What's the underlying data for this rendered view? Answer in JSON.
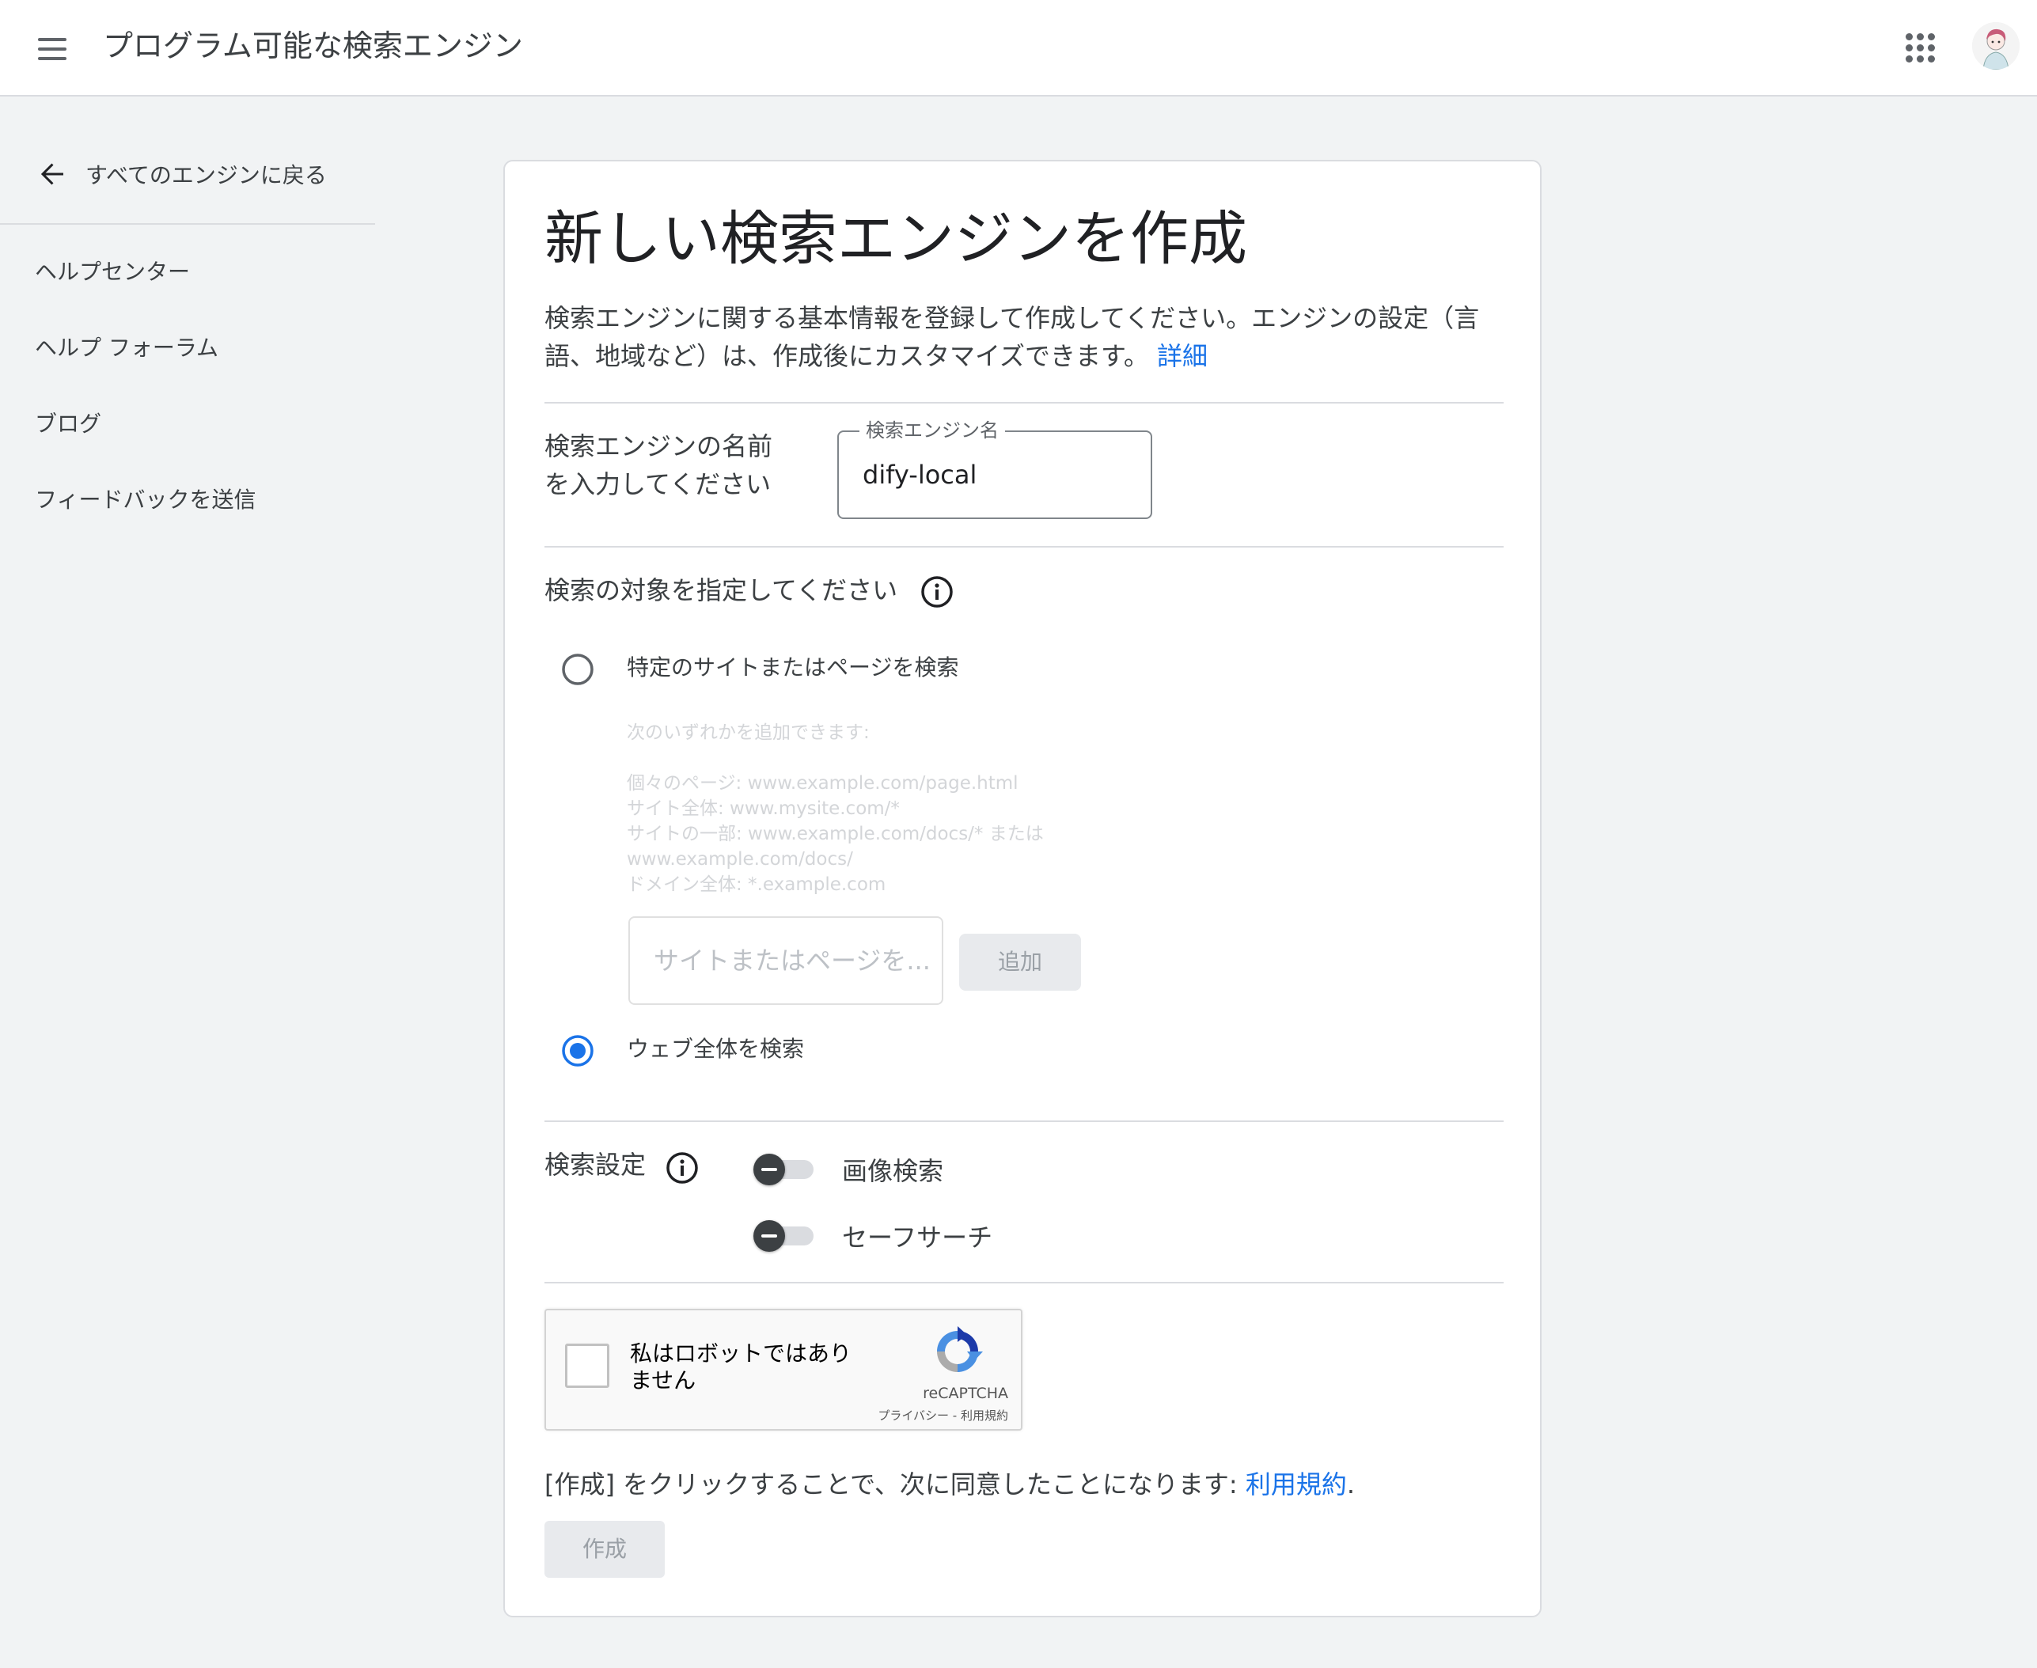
{
  "header": {
    "menu_icon": "hamburger-menu-icon",
    "title": "プログラム可能な検索エンジン",
    "apps_icon": "apps-grid-icon",
    "avatar_icon": "user-avatar"
  },
  "sidebar": {
    "back_label": "すべてのエンジンに戻る",
    "back_icon": "arrow-back-icon",
    "items": [
      {
        "label": "ヘルプセンター"
      },
      {
        "label": "ヘルプ フォーラム"
      },
      {
        "label": "ブログ"
      },
      {
        "label": "フィードバックを送信"
      }
    ]
  },
  "form": {
    "title": "新しい検索エンジンを作成",
    "description_line1": "検索エンジンに関する基本情報を登録して作成してください。エンジンの設定（言",
    "description_line2": "語、地域など）は、作成後にカスタマイズできます。",
    "details_link": "詳細",
    "name_label_line1": "検索エンジンの名前",
    "name_label_line2": "を入力してください",
    "name_field_legend": "検索エンジン名",
    "name_field_value": "dify-local",
    "target_label": "検索の対象を指定してください",
    "target_options": [
      {
        "label": "特定のサイトまたはページを検索",
        "selected": false
      },
      {
        "label": "ウェブ全体を検索",
        "selected": true
      }
    ],
    "hint_lines": [
      "次のいずれかを追加できます:",
      "個々のページ: www.example.com/page.html",
      "サイト全体: www.mysite.com/*",
      "サイトの一部: www.example.com/docs/* または",
      "www.example.com/docs/",
      "ドメイン全体: *.example.com"
    ],
    "site_input_placeholder": "サイトまたはページを...",
    "add_button_label": "追加",
    "settings_label": "検索設定",
    "toggles": [
      {
        "label": "画像検索",
        "state": "indeterminate"
      },
      {
        "label": "セーフサーチ",
        "state": "indeterminate"
      }
    ],
    "recaptcha": {
      "line1": "私はロボットではあり",
      "line2": "ません",
      "brand": "reCAPTCHA",
      "terms": "プライバシー - 利用規約"
    },
    "agree_text": "[作成] をクリックすることで、次に同意したことになります: ",
    "agree_link": "利用規約",
    "agree_end": ".",
    "create_button_label": "作成"
  },
  "colors": {
    "accent": "#1a73e8",
    "background": "#f1f3f4",
    "card": "#ffffff",
    "divider": "#dadce0"
  }
}
